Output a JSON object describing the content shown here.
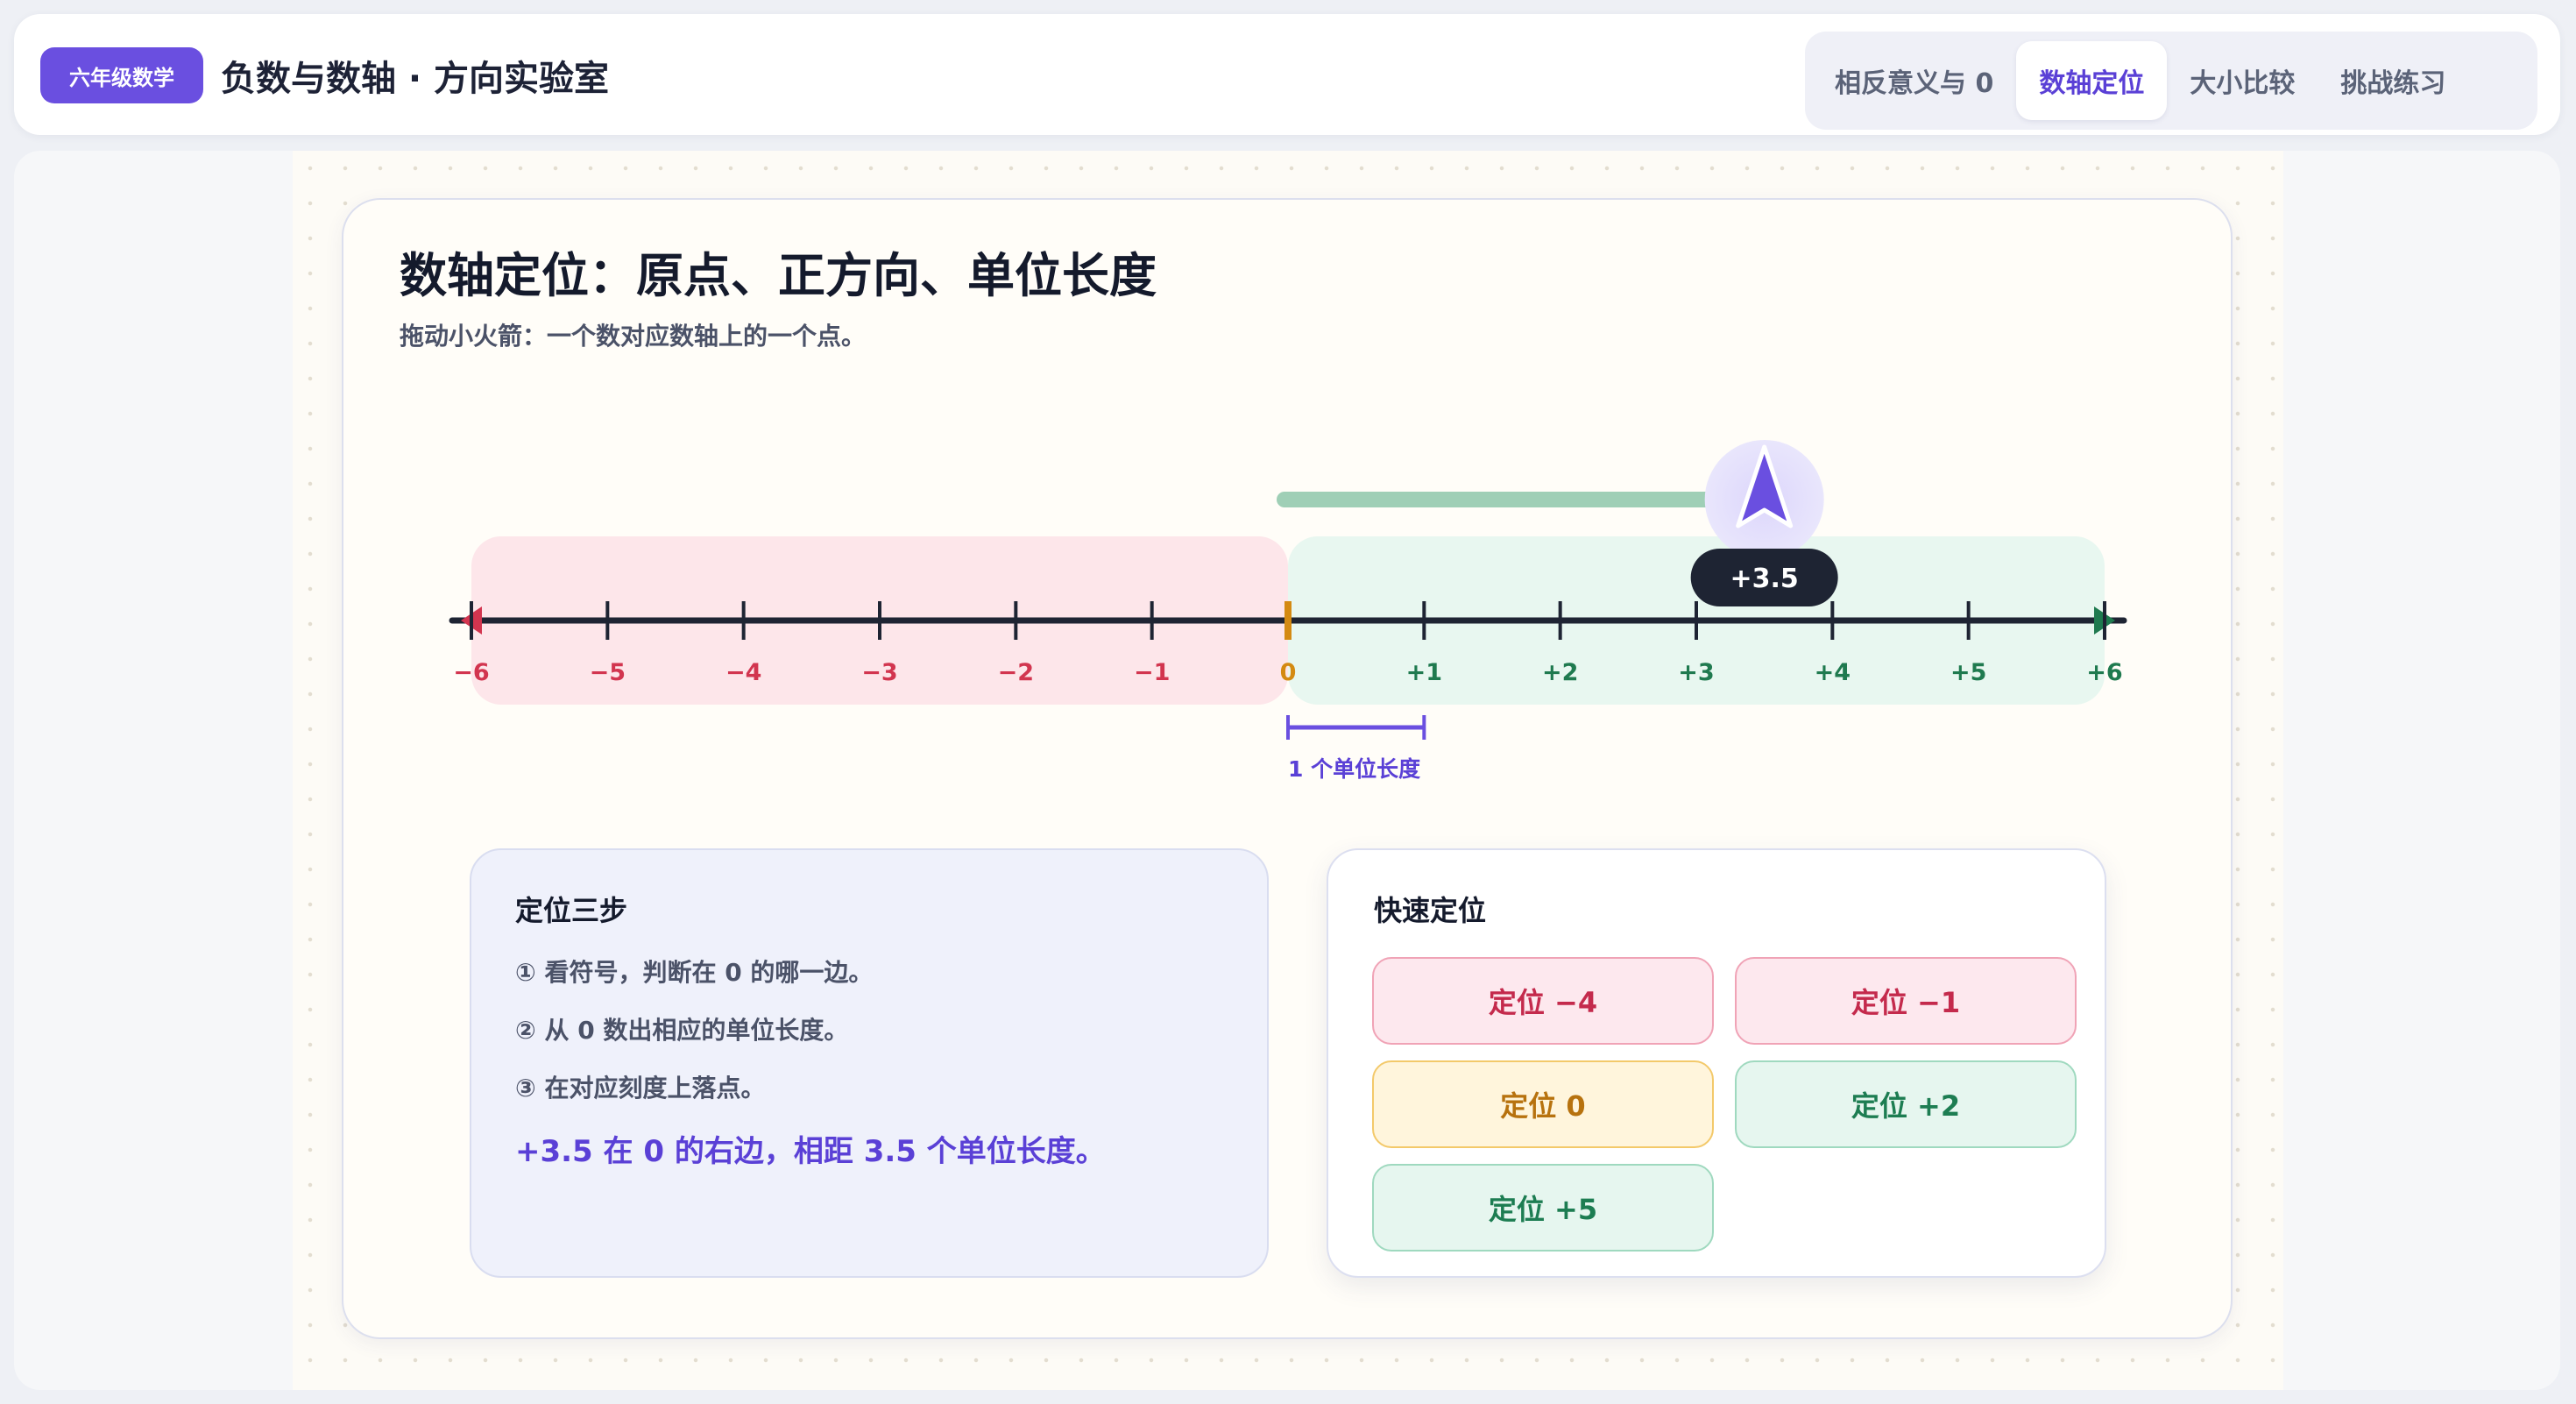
{
  "header": {
    "badge": "六年级数学",
    "title": "负数与数轴 · 方向实验室",
    "tabs": [
      {
        "label": "相反意义与 0",
        "active": false
      },
      {
        "label": "数轴定位",
        "active": true
      },
      {
        "label": "大小比较",
        "active": false
      },
      {
        "label": "挑战练习",
        "active": false
      }
    ]
  },
  "section": {
    "title": "数轴定位：原点、正方向、单位长度",
    "subtitle": "拖动小火箭：一个数对应数轴上的一个点。"
  },
  "number_line": {
    "min": -6,
    "max": 6,
    "tick_labels": [
      "−6",
      "−5",
      "−4",
      "−3",
      "−2",
      "−1",
      "0",
      "+1",
      "+2",
      "+3",
      "+4",
      "+5",
      "+6"
    ],
    "marker_value": 3.5,
    "marker_label": "+3.5",
    "unit_label": "1 个单位长度",
    "colors": {
      "negative": "#d2354f",
      "zero": "#d48a12",
      "positive": "#1f7a4f",
      "axis": "#1e2433",
      "rocket": "#6a4fe0"
    }
  },
  "steps": {
    "title": "定位三步",
    "items": [
      "① 看符号，判断在 0 的哪一边。",
      "② 从 0 数出相应的单位长度。",
      "③ 在对应刻度上落点。"
    ],
    "result": "+3.5 在 0 的右边，相距 3.5 个单位长度。"
  },
  "quick": {
    "title": "快速定位",
    "buttons": [
      {
        "label": "定位 −4",
        "tone": "neg"
      },
      {
        "label": "定位 −1",
        "tone": "neg"
      },
      {
        "label": "定位 0",
        "tone": "zero"
      },
      {
        "label": "定位 +2",
        "tone": "pos"
      },
      {
        "label": "定位 +5",
        "tone": "pos"
      }
    ]
  }
}
